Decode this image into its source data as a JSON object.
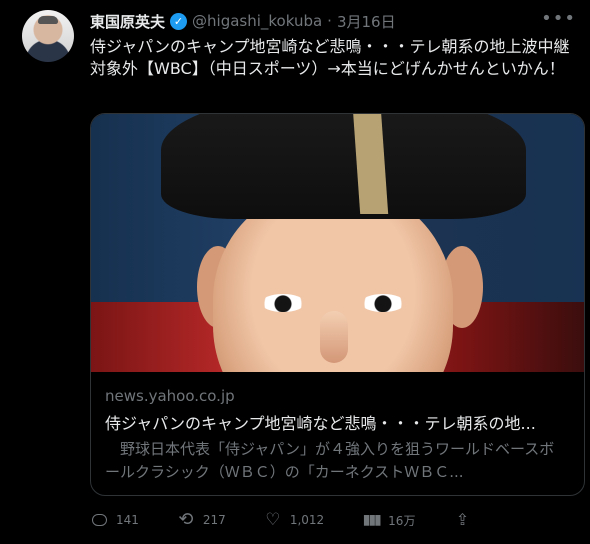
{
  "tweet": {
    "author_name": "東国原英夫",
    "author_handle": "@higashi_kokuba",
    "separator": "·",
    "date": "3月16日",
    "more_icon": "more-icon",
    "text": "侍ジャパンのキャンプ地宮崎など悲鳴・・・テレ朝系の地上波中継対象外【WBC】（中日スポーツ）→本当にどげんかせんといかん！",
    "verified_icon": "verified-badge-icon"
  },
  "card": {
    "domain": "news.yahoo.co.jp",
    "title": "侍ジャパンのキャンプ地宮崎など悲鳴・・・テレ朝系の地...",
    "description": "　野球日本代表「侍ジャパン」が４強入りを狙うワールドベースボールクラシック（ＷＢＣ）の「カーネクストＷＢＣ..."
  },
  "actions": {
    "reply_count": "141",
    "retweet_count": "217",
    "like_count": "1,012",
    "views_count": "16万",
    "icons": [
      "reply-icon",
      "retweet-icon",
      "like-icon",
      "views-icon",
      "share-icon"
    ]
  },
  "colors": {
    "background": "#000000",
    "text_primary": "#e7e9ea",
    "text_secondary": "#71767b",
    "verified_blue": "#1d9bf0",
    "card_border": "#2f3336"
  }
}
